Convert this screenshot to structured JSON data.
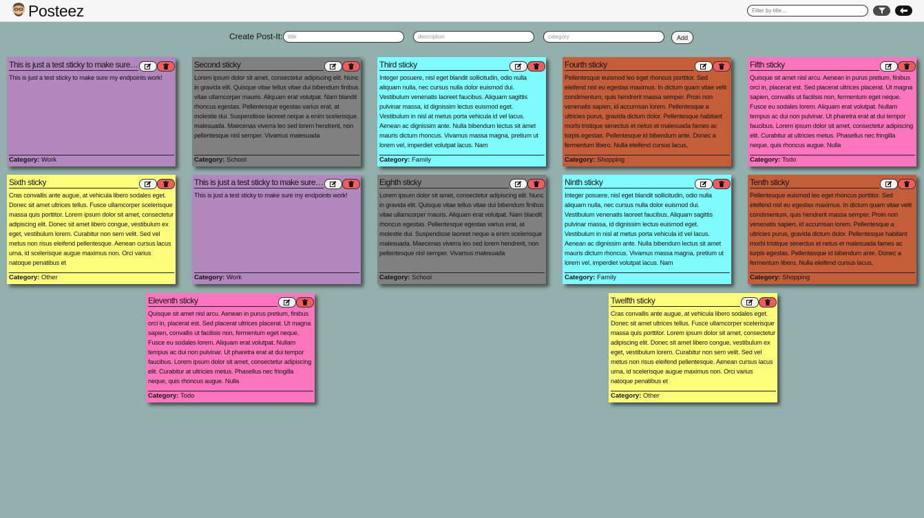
{
  "app": {
    "name": "Posteez"
  },
  "filter": {
    "placeholder": "Filter by title..."
  },
  "create": {
    "label": "Create Post-It:",
    "title_placeholder": "title",
    "description_placeholder": "description",
    "category_placeholder": "category",
    "add_label": "Add"
  },
  "category_label": "Category:",
  "colors": {
    "Work": "#b187bd",
    "School": "#808080",
    "Family": "#7ffbfd",
    "Shopping": "#c45d3a",
    "Todo": "#fb76bd",
    "Other": "#fdfd7c"
  },
  "cards": [
    {
      "title": "This is just a test sticky to make sure my endpoints work!",
      "body": "This is just a test sticky to make sure my endpoints work!",
      "category": "Work"
    },
    {
      "title": "Second sticky",
      "body": "Lorem ipsum dolor sit amet, consectetur adipiscing elit. Nunc in gravida elit. Quisque vitae tellus vitae dui bibendum finibus vitae ullamcorper mauris. Aliquam erat volutpat. Nam blandit rhoncus egestas. Pellentesque egestas varius erat, at molestie dui. Suspendisse laoreet neque a enim scelerisque malesuada. Maecenas viverra leo sed lorem hendrerit, non pellentesque nisl semper. Vivamus malesuada",
      "category": "School"
    },
    {
      "title": "Third sticky",
      "body": "Integer posuere, nisl eget blandit sollicitudin, odio nulla aliquam nulla, nec cursus nulla dolor euismod dui. Vestibulum venenatis laoreet faucibus. Aliquam sagittis pulvinar massa, id dignissim lectus euismod eget. Vestibulum in nisl at metus porta vehicula id vel lacus. Aenean ac dignissim ante. Nulla bibendum lectus sit amet mauris dictum rhoncus. Vivamus massa magna, pretium ut lorem vel, imperdiet volutpat lacus. Nam",
      "category": "Family"
    },
    {
      "title": "Fourth sticky",
      "body": "Pellentesque euismod leo eget rhoncus porttitor. Sed eleifend nisl eu egestas maximus. In dictum quam vitae velit condimentum, quis hendrerit massa semper. Proin non venenatis sapien, id accumsan lorem. Pellentesque a ultricies purus, gravida dictum dolor. Pellentesque habitant morbi tristique senectus et netus et malesuada fames ac turpis egestas. Pellentesque id bibendum ante. Donec a fermentum libero. Nulla eleifend cursus lacus,",
      "category": "Shopping"
    },
    {
      "title": "Fifth sticky",
      "body": "Quisque sit amet nisl arcu. Aenean in purus pretium, finibus orci in, placerat est. Sed placerat ultrices placerat. Ut magna sapien, convallis ut facilisis non, fermentum eget neque. Fusce eu sodales lorem. Aliquam erat volutpat. Nullam tempus ac dui non pulvinar. Ut pharetra erat at dui tempor faucibus. Lorem ipsum dolor sit amet, consectetur adipiscing elit. Curabitur at ultricies metus. Phasellus nec fringilla neque, quis rhoncus augue. Nulla",
      "category": "Todo"
    },
    {
      "title": "Sixth sticky",
      "body": "Cras convallis ante augue, at vehicula libero sodales eget. Donec sit amet ultrices tellus. Fusce ullamcorper scelerisque massa quis porttitor. Lorem ipsum dolor sit amet, consectetur adipiscing elit. Donec sit amet libero congue, vestibulum ex eget, vestibulum lorem. Curabitur non sem velit. Sed vel metus non risus eleifend pellentesque. Aenean cursus lacus urna, id scelerisque augue maximus non. Orci varius natoque penatibus et",
      "category": "Other"
    },
    {
      "title": "This is just a test sticky to make sure my endpoints work!",
      "body": "This is just a test sticky to make sure my endpoints work!",
      "category": "Work"
    },
    {
      "title": "Eighth sticky",
      "body": "Lorem ipsum dolor sit amet, consectetur adipiscing elit. Nunc in gravida elit. Quisque vitae tellus vitae dui bibendum finibus vitae ullamcorper mauris. Aliquam erat volutpat. Nam blandit rhoncus egestas. Pellentesque egestas varius erat, at molestie dui. Suspendisse laoreet neque a enim scelerisque malesuada. Maecenas viverra leo sed lorem hendrerit, non pellentesque nisl semper. Vivamus malesuada",
      "category": "School"
    },
    {
      "title": "Ninth sticky",
      "body": "Integer posuere, nisl eget blandit sollicitudin, odio nulla aliquam nulla, nec cursus nulla dolor euismod dui. Vestibulum venenatis laoreet faucibus. Aliquam sagittis pulvinar massa, id dignissim lectus euismod eget. Vestibulum in nisl at metus porta vehicula id vel lacus. Aenean ac dignissim ante. Nulla bibendum lectus sit amet mauris dictum rhoncus. Vivamus massa magna, pretium ut lorem vel, imperdiet volutpat lacus. Nam",
      "category": "Family"
    },
    {
      "title": "Tenth sticky",
      "body": "Pellentesque euismod leo eget rhoncus porttitor. Sed eleifend nisl eu egestas maximus. In dictum quam vitae velit condimentum, quis hendrerit massa semper. Proin non venenatis sapien, id accumsan lorem. Pellentesque a ultricies purus, gravida dictum dolor. Pellentesque habitant morbi tristique senectus et netus et malesuada fames ac turpis egestas. Pellentesque id bibendum ante. Donec a fermentum libero. Nulla eleifend cursus lacus,",
      "category": "Shopping"
    },
    {
      "title": "Eleventh sticky",
      "body": "Quisque sit amet nisl arcu. Aenean in purus pretium, finibus orci in, placerat est. Sed placerat ultrices placerat. Ut magna sapien, convallis ut facilisis non, fermentum eget neque. Fusce eu sodales lorem. Aliquam erat volutpat. Nullam tempus ac dui non pulvinar. Ut pharetra erat at dui tempor faucibus. Lorem ipsum dolor sit amet, consectetur adipiscing elit. Curabitur at ultricies metus. Phasellus nec fringilla neque, quis rhoncus augue. Nulla",
      "category": "Todo"
    },
    {
      "title": "Twelfth sticky",
      "body": "Cras convallis ante augue, at vehicula libero sodales eget. Donec sit amet ultrices tellus. Fusce ullamcorper scelerisque massa quis porttitor. Lorem ipsum dolor sit amet, consectetur adipiscing elit. Donec sit amet libero congue, vestibulum ex eget, vestibulum lorem. Curabitur non sem velit. Sed vel metus non risus eleifend pellentesque. Aenean cursus lacus urna, id scelerisque augue maximus non. Orci varius natoque penatibus et",
      "category": "Other"
    }
  ]
}
